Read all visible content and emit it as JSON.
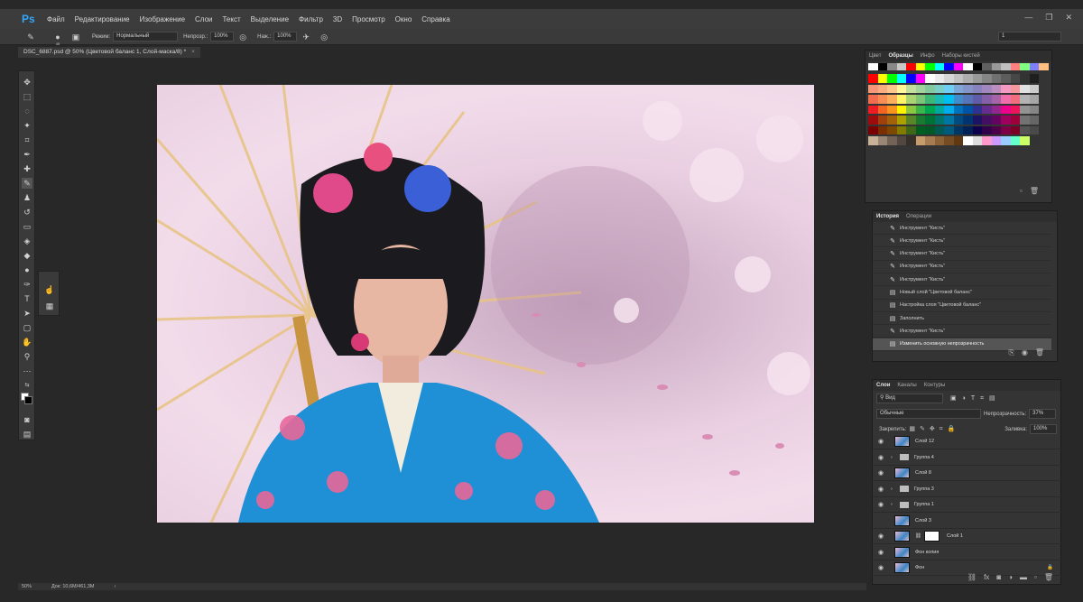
{
  "app": {
    "logo": "Ps"
  },
  "menu": [
    "Файл",
    "Редактирование",
    "Изображение",
    "Слои",
    "Текст",
    "Выделение",
    "Фильтр",
    "3D",
    "Просмотр",
    "Окно",
    "Справка"
  ],
  "window_controls": [
    "—",
    "❐",
    "✕"
  ],
  "options": {
    "brush_size": "45",
    "mode_label": "Режим:",
    "mode_value": "Нормальный",
    "opacity_label": "Непрозр.:",
    "opacity_value": "100%",
    "flow_label": "Наж.:",
    "flow_value": "100%",
    "right_value": "1"
  },
  "document_tab": {
    "title": "DSC_6887.psd @ 50% (Цветовой баланс 1, Слой-маска/8) *",
    "close": "×"
  },
  "status": {
    "zoom": "50%",
    "doc": "Док: 10,6M/461,3M",
    "arrow": "›"
  },
  "swatches_panel": {
    "tabs": [
      "Цвет",
      "Образцы",
      "Инфо",
      "Наборы кистей"
    ],
    "active_tab": "Образцы",
    "top_row": [
      "#ffffff",
      "#000000",
      "#888888",
      "#c8c8c8",
      "#ff0000",
      "#ffff00",
      "#00ff00",
      "#00ffff",
      "#0000ff",
      "#ff00ff",
      "#ffffff",
      "#000000",
      "#606060",
      "#999999",
      "#c0c0c0",
      "#ff8080",
      "#80ff80",
      "#8080ff",
      "#ffbf80"
    ],
    "colors": [
      [
        "#ff0000",
        "#ffff00",
        "#00ff00",
        "#00ffff",
        "#0000ff",
        "#ff00ff",
        "#ffffff",
        "#ebebeb",
        "#d6d6d6",
        "#c2c2c2",
        "#adadad",
        "#999999",
        "#858585",
        "#707070",
        "#5c5c5c",
        "#474747",
        "#333333",
        "#1f1f1f"
      ],
      [
        "#f7977a",
        "#f9ad81",
        "#fdc68a",
        "#fff79a",
        "#c4df9b",
        "#a2d39c",
        "#82ca9d",
        "#7bcdc8",
        "#6ecff6",
        "#7ea7d8",
        "#8493ca",
        "#8882be",
        "#a187be",
        "#bc8dbf",
        "#f49ac2",
        "#f6989d",
        "#e0e0e0",
        "#cccccc"
      ],
      [
        "#f26c4f",
        "#f68e55",
        "#fbaf5c",
        "#fff467",
        "#acd372",
        "#7cc576",
        "#3bb878",
        "#1abbb4",
        "#00bff3",
        "#438ccb",
        "#5574b9",
        "#605ca8",
        "#855fa8",
        "#a763a8",
        "#f06ea9",
        "#f26d7d",
        "#b3b3b3",
        "#a6a6a6"
      ],
      [
        "#ed1c24",
        "#f26522",
        "#f7941d",
        "#fff200",
        "#8dc63f",
        "#39b54a",
        "#00a651",
        "#00a99d",
        "#00aeef",
        "#0072bc",
        "#0054a6",
        "#2e3192",
        "#662d91",
        "#92278f",
        "#ec008c",
        "#ed145b",
        "#939393",
        "#868686"
      ],
      [
        "#9e0b0f",
        "#a0410d",
        "#a3620a",
        "#aba000",
        "#598527",
        "#1a7b30",
        "#007236",
        "#00746b",
        "#0076a3",
        "#004b80",
        "#003471",
        "#1b1464",
        "#440e62",
        "#630460",
        "#9e005d",
        "#9e0039",
        "#737373",
        "#666666"
      ],
      [
        "#790000",
        "#7b2e00",
        "#7d4900",
        "#827b00",
        "#406618",
        "#005e20",
        "#005826",
        "#005952",
        "#005b7f",
        "#003663",
        "#002157",
        "#0d004c",
        "#32004b",
        "#4b0049",
        "#7b0046",
        "#7a0026",
        "#555555",
        "#4a4a4a"
      ],
      [
        "#c7b299",
        "#998675",
        "#736357",
        "#534741",
        "#37302a",
        "#c69c6d",
        "#a67c52",
        "#8c6239",
        "#754c24",
        "#603913",
        "#ffffff",
        "#dddddd",
        "#ff99cc",
        "#cc99ff",
        "#99ccff",
        "#66ffcc",
        "#ccff66",
        "#333333"
      ]
    ]
  },
  "history_panel": {
    "tabs": [
      "История",
      "Операции"
    ],
    "active_tab": "История",
    "items": [
      {
        "icon": "brush",
        "label": "Инструмент \"Кисть\""
      },
      {
        "icon": "brush",
        "label": "Инструмент \"Кисть\""
      },
      {
        "icon": "brush",
        "label": "Инструмент \"Кисть\""
      },
      {
        "icon": "brush",
        "label": "Инструмент \"Кисть\""
      },
      {
        "icon": "brush",
        "label": "Инструмент \"Кисть\""
      },
      {
        "icon": "doc",
        "label": "Новый слой \"Цветовой баланс\""
      },
      {
        "icon": "doc",
        "label": "Настройка слоя \"Цветовой баланс\""
      },
      {
        "icon": "doc",
        "label": "Заполнить"
      },
      {
        "icon": "brush",
        "label": "Инструмент \"Кисть\""
      },
      {
        "icon": "doc",
        "label": "Изменить основную непрозрачность"
      }
    ],
    "selected_index": 9
  },
  "layers_panel": {
    "tabs": [
      "Слои",
      "Каналы",
      "Контуры"
    ],
    "active_tab": "Слои",
    "filter": "Вид",
    "blend_mode": "Обычные",
    "opacity_label": "Непрозрачность:",
    "opacity_value": "37%",
    "lock_label": "Закрепить:",
    "fill_label": "Заливка:",
    "fill_value": "100%",
    "layers": [
      {
        "name": "Слой 12",
        "type": "layer",
        "visible": true
      },
      {
        "name": "Группа 4",
        "type": "group",
        "visible": true
      },
      {
        "name": "Слой 8",
        "type": "layer",
        "visible": true
      },
      {
        "name": "Группа 3",
        "type": "group",
        "visible": true
      },
      {
        "name": "Группа 1",
        "type": "group",
        "visible": true
      },
      {
        "name": "Слой 3",
        "type": "layer",
        "visible": false
      },
      {
        "name": "Слой 1",
        "type": "masked",
        "visible": true
      },
      {
        "name": "Фон копия",
        "type": "layer",
        "visible": true
      },
      {
        "name": "Фон",
        "type": "locked",
        "visible": true
      }
    ]
  }
}
